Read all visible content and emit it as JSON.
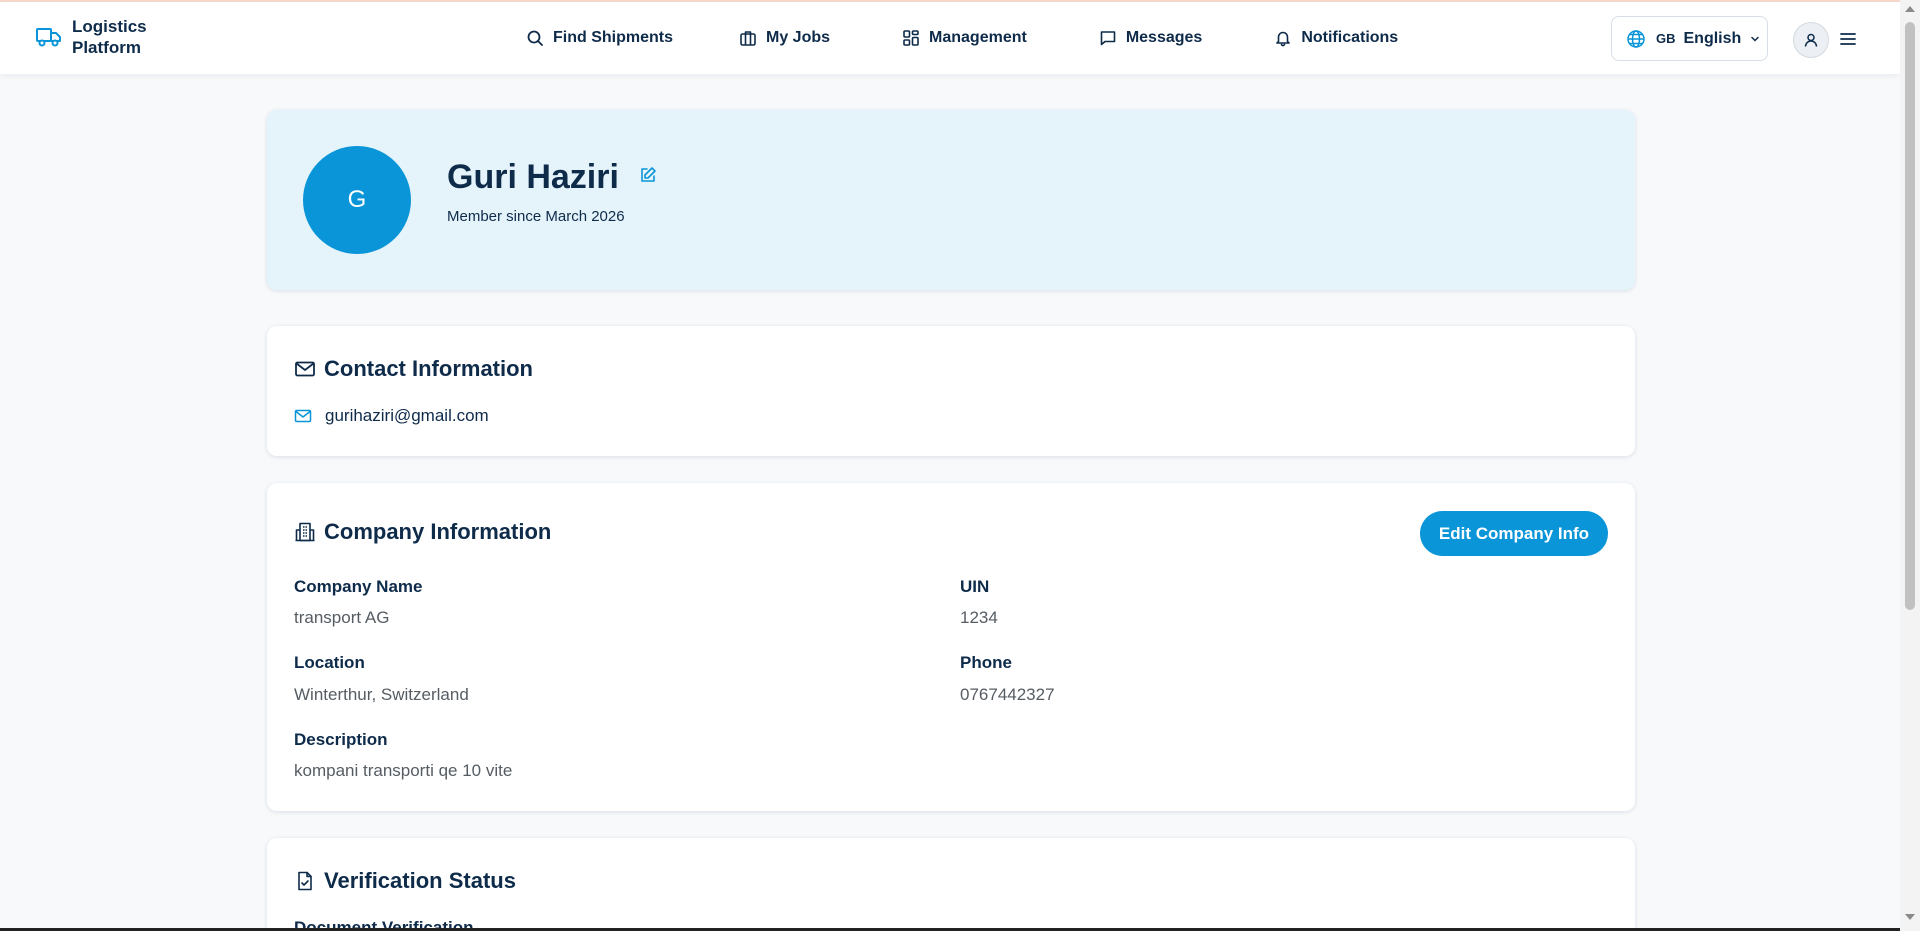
{
  "brand": {
    "line1": "Logistics",
    "line2": "Platform",
    "icon": "truck-icon"
  },
  "nav": [
    {
      "label": "Find Shipments",
      "icon": "search-icon"
    },
    {
      "label": "My Jobs",
      "icon": "briefcase-icon"
    },
    {
      "label": "Management",
      "icon": "dashboard-icon"
    },
    {
      "label": "Messages",
      "icon": "message-icon"
    },
    {
      "label": "Notifications",
      "icon": "bell-icon"
    }
  ],
  "language": {
    "code": "GB",
    "name": "English"
  },
  "profile": {
    "initial": "G",
    "name": "Guri Haziri",
    "member_since": "Member since March 2026"
  },
  "contact": {
    "title": "Contact Information",
    "email": "gurihaziri@gmail.com"
  },
  "company": {
    "title": "Company Information",
    "edit_label": "Edit Company Info",
    "fields": {
      "company_name": {
        "label": "Company Name",
        "value": "transport AG"
      },
      "uin": {
        "label": "UIN",
        "value": "1234"
      },
      "location": {
        "label": "Location",
        "value": "Winterthur, Switzerland"
      },
      "phone": {
        "label": "Phone",
        "value": "0767442327"
      },
      "description": {
        "label": "Description",
        "value": "kompani transporti qe 10 vite"
      }
    }
  },
  "verification": {
    "title": "Verification Status",
    "document_label": "Document Verification"
  },
  "colors": {
    "primary": "#0a95d8",
    "text": "#0e2b4a",
    "profile_bg": "#e5f4fb"
  }
}
